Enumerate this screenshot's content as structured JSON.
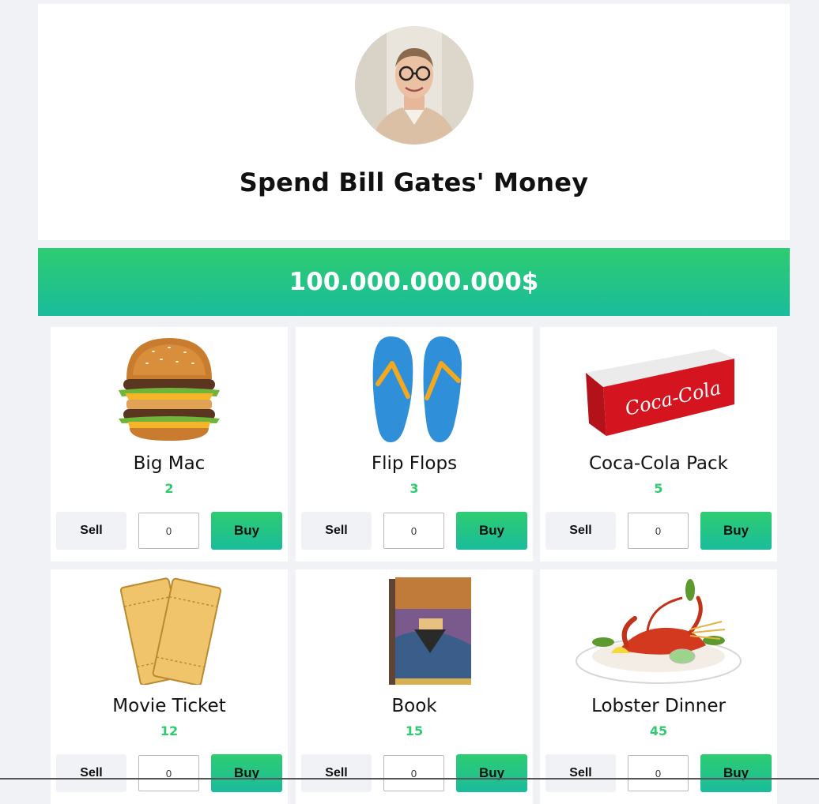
{
  "header": {
    "title": "Spend Bill Gates' Money",
    "avatar": "bill-gates-portrait"
  },
  "balance": "100.000.000.000$",
  "colors": {
    "accent_start": "#2ecc71",
    "accent_end": "#1abc9c",
    "background": "#f1f2f6"
  },
  "products": [
    {
      "name": "Big Mac",
      "price": "2",
      "quantity": "0",
      "sell_label": "Sell",
      "buy_label": "Buy",
      "image": "burger-image"
    },
    {
      "name": "Flip Flops",
      "price": "3",
      "quantity": "0",
      "sell_label": "Sell",
      "buy_label": "Buy",
      "image": "flip-flops-image"
    },
    {
      "name": "Coca-Cola Pack",
      "price": "5",
      "quantity": "0",
      "sell_label": "Sell",
      "buy_label": "Buy",
      "image": "coca-cola-pack-image"
    },
    {
      "name": "Movie Ticket",
      "price": "12",
      "quantity": "0",
      "sell_label": "Sell",
      "buy_label": "Buy",
      "image": "movie-ticket-image"
    },
    {
      "name": "Book",
      "price": "15",
      "quantity": "0",
      "sell_label": "Sell",
      "buy_label": "Buy",
      "image": "book-image"
    },
    {
      "name": "Lobster Dinner",
      "price": "45",
      "quantity": "0",
      "sell_label": "Sell",
      "buy_label": "Buy",
      "image": "lobster-dinner-image"
    }
  ]
}
